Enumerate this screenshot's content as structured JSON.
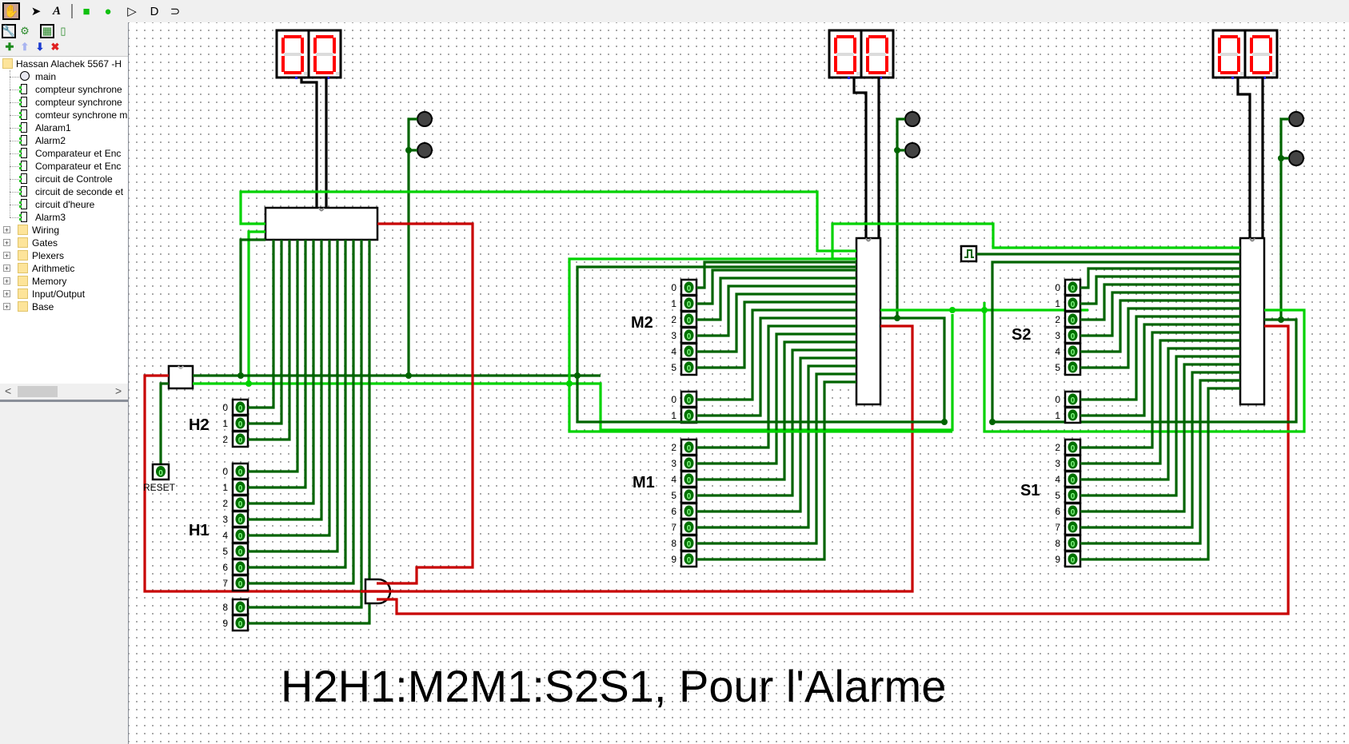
{
  "toolbar": {
    "tools": [
      {
        "name": "poke-tool-icon",
        "glyph": "✋",
        "selected": true
      },
      {
        "name": "select-tool-icon",
        "glyph": "➤",
        "selected": false
      },
      {
        "name": "text-tool-icon",
        "glyph": "A",
        "selected": false
      },
      {
        "name": "input-pin-icon",
        "glyph": "■",
        "selected": false
      },
      {
        "name": "output-pin-icon",
        "glyph": "●",
        "selected": false
      },
      {
        "name": "not-gate-icon",
        "glyph": "▷",
        "selected": false
      },
      {
        "name": "and-gate-icon",
        "glyph": "D",
        "selected": false
      },
      {
        "name": "or-gate-icon",
        "glyph": "⊃",
        "selected": false
      }
    ]
  },
  "panel": {
    "tools": [
      {
        "name": "wrench-icon",
        "glyph": "🔧",
        "selected": true
      },
      {
        "name": "simulate-tree-icon",
        "glyph": "⚙",
        "selected": false
      },
      {
        "name": "layout-view-icon",
        "glyph": "▦",
        "selected": true
      },
      {
        "name": "appearance-icon",
        "glyph": "▯",
        "selected": false
      }
    ],
    "actions": [
      {
        "name": "add-circuit-icon",
        "glyph": "✚",
        "color": "#1a8a1a"
      },
      {
        "name": "move-up-icon",
        "glyph": "⬆",
        "color": "#a8b4f0"
      },
      {
        "name": "move-down-icon",
        "glyph": "⬇",
        "color": "#1a3ad0"
      },
      {
        "name": "delete-circuit-icon",
        "glyph": "✖",
        "color": "#e02020"
      }
    ]
  },
  "tree": {
    "project": "Hassan Alachek 5567 -H",
    "circuits": [
      "main",
      "compteur synchrone",
      "compteur synchrone",
      "comteur synchrone m",
      "Alaram1",
      "Alarm2",
      "Comparateur et Enc",
      "Comparateur et Enc",
      "circuit de Controle",
      "circuit de seconde et",
      "circuit d'heure",
      "Alarm3"
    ],
    "libraries": [
      "Wiring",
      "Gates",
      "Plexers",
      "Arithmetic",
      "Memory",
      "Input/Output",
      "Base"
    ]
  },
  "scroll": {
    "left": "<",
    "right": ">"
  },
  "canvas": {
    "displays": [
      {
        "id": "hours",
        "digits": [
          "0",
          "0"
        ]
      },
      {
        "id": "minutes",
        "digits": [
          "0",
          "0"
        ]
      },
      {
        "id": "seconds",
        "digits": [
          "0",
          "0"
        ]
      }
    ],
    "group_labels": {
      "H2": "H2",
      "H1": "H1",
      "M2": "M2",
      "M1": "M1",
      "S2": "S2",
      "S1": "S1"
    },
    "pin_value": "0",
    "reset_label": "RESET",
    "pins": {
      "H2": [
        "0",
        "1",
        "2"
      ],
      "H1": [
        "0",
        "1",
        "2",
        "3",
        "4",
        "5",
        "6",
        "7",
        "8",
        "9"
      ],
      "M2": [
        "0",
        "1",
        "2",
        "3",
        "4",
        "5"
      ],
      "M1top": [
        "0",
        "1"
      ],
      "M1": [
        "2",
        "3",
        "4",
        "5",
        "6",
        "7",
        "8",
        "9"
      ],
      "S2": [
        "0",
        "1",
        "2",
        "3",
        "4",
        "5"
      ],
      "S1top": [
        "0",
        "1"
      ],
      "S1": [
        "2",
        "3",
        "4",
        "5",
        "6",
        "7",
        "8",
        "9"
      ]
    },
    "caption": "H2H1:M2M1:S2S1, Pour l'Alarme"
  },
  "colors": {
    "wire_dark": "#006400",
    "wire_light": "#00d200",
    "wire_red": "#c80000",
    "segment_on": "#ff0000",
    "segment_off": "#dcdcdc"
  }
}
